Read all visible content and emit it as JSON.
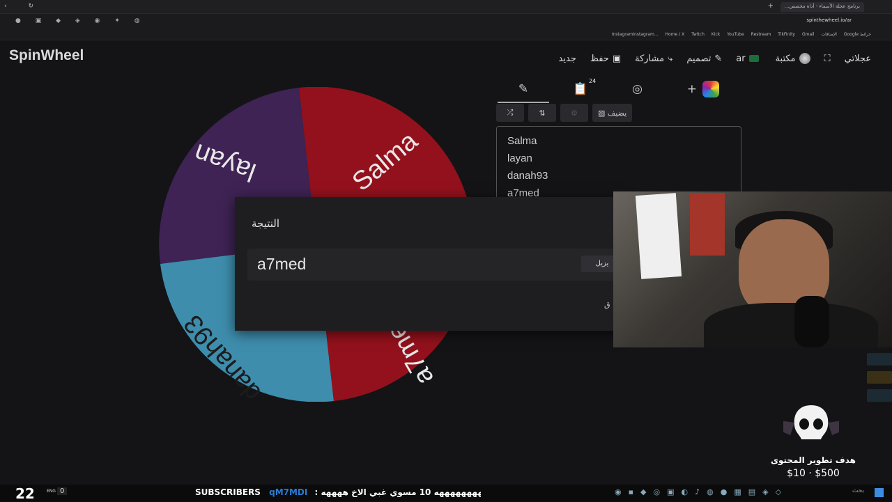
{
  "browser": {
    "tab_title": "برنامج عجلة الأسماء - أداة مخصص...",
    "new_tab": "+",
    "url": "spinthewheel.io/ar",
    "window_controls": "‹ ↻",
    "bookmarks": [
      "InstagramInstagram...",
      "Home / X",
      "Twitch",
      "Kick",
      "YouTube",
      "Restream",
      "TikFinity",
      "Gmail",
      "الإضافات",
      "Google خرائط"
    ]
  },
  "app": {
    "logo": "SpinWheel",
    "nav": {
      "quick": "عجلاتي",
      "library": "مكتبة",
      "lang": "ar",
      "design": "تصميم",
      "share": "مشاركة",
      "save": "حفظ",
      "new": "جديد"
    },
    "tools": {
      "entries_count": "24",
      "add": "+",
      "add_image": "يضيف"
    },
    "entries": [
      "Salma",
      "layan",
      "danah93",
      "a7med"
    ],
    "wheel_labels": [
      "Salma",
      "layan",
      "danah93",
      "a7med"
    ],
    "wheel_colors": {
      "red": "#93111c",
      "purple": "#3e2354",
      "blue": "#3e8dad"
    }
  },
  "dialog": {
    "title": "النتيجة",
    "result": "a7med",
    "remove": "يزيل",
    "close": "ق"
  },
  "overlay": {
    "goal_title": "هدف تطوير المحتوى",
    "goal_amount": "$10 · $500"
  },
  "taskbar": {
    "counter": "22",
    "lang": "ENG",
    "zero": "0",
    "subscribers_label": "SUBSCRIBERS",
    "ticker_user": "qM7MDI",
    "ticker_msg": ": ههههههههههههههههههههه 10 مسوي غبي الاخ ههههه",
    "search": "بحث"
  }
}
